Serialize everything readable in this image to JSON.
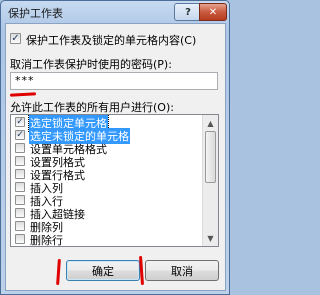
{
  "window": {
    "title": "保护工作表",
    "help_label": "?",
    "close_label": "✕"
  },
  "protect_option": {
    "label": "保护工作表及锁定的单元格内容(C)",
    "checked": "✓"
  },
  "password": {
    "label": "取消工作表保护时使用的密码(P):",
    "value": "***"
  },
  "permissions": {
    "label": "允许此工作表的所有用户进行(O):",
    "items": [
      {
        "label": "选定锁定单元格",
        "checked": "✓"
      },
      {
        "label": "选定未锁定的单元格",
        "checked": "✓"
      },
      {
        "label": "设置单元格格式",
        "checked": ""
      },
      {
        "label": "设置列格式",
        "checked": ""
      },
      {
        "label": "设置行格式",
        "checked": ""
      },
      {
        "label": "插入列",
        "checked": ""
      },
      {
        "label": "插入行",
        "checked": ""
      },
      {
        "label": "插入超链接",
        "checked": ""
      },
      {
        "label": "删除列",
        "checked": ""
      },
      {
        "label": "删除行",
        "checked": ""
      }
    ]
  },
  "scrollbar": {
    "up_icon": "▲",
    "down_icon": "▼"
  },
  "buttons": {
    "ok": "确定",
    "cancel": "取消"
  },
  "colors": {
    "annotation_red": "#e00000",
    "selection_blue": "#3399ff"
  }
}
